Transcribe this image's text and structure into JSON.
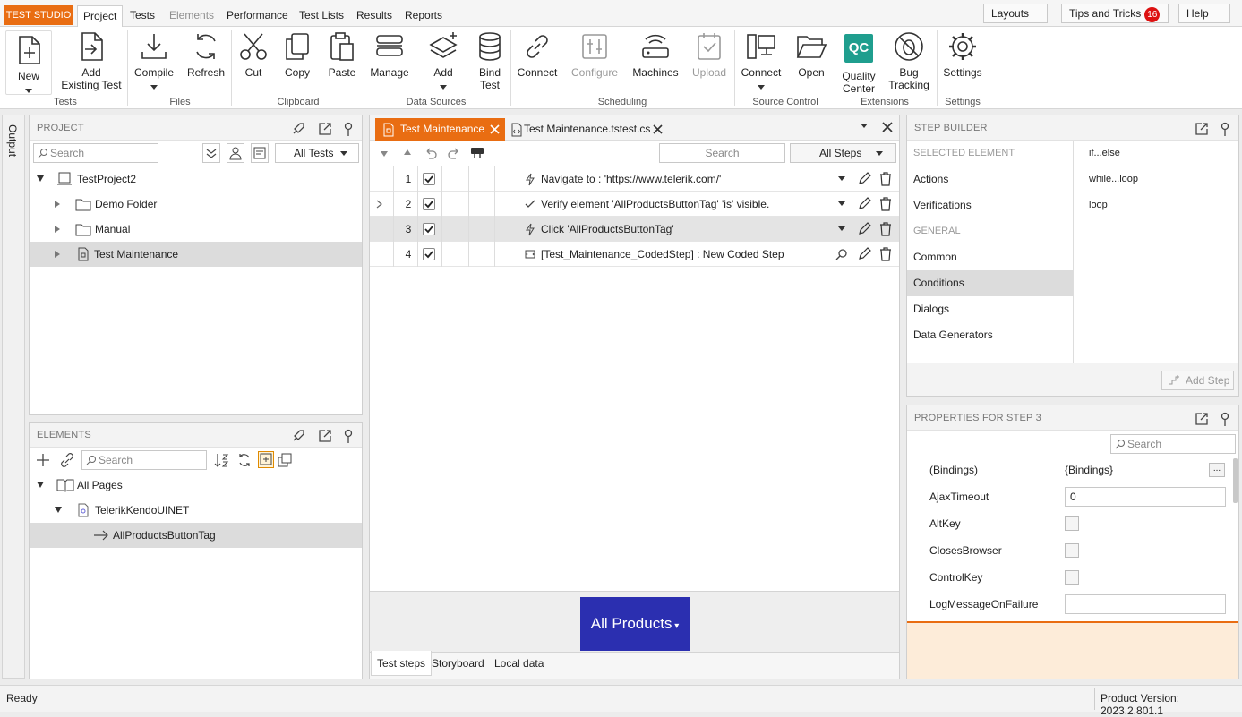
{
  "menubar": {
    "brand": "TEST STUDIO",
    "tabs": [
      "Project",
      "Tests",
      "Elements",
      "Performance",
      "Test Lists",
      "Results",
      "Reports"
    ],
    "layouts": "Layouts",
    "tips": "Tips and Tricks",
    "tips_count": "16",
    "help": "Help"
  },
  "ribbon": {
    "new": "New",
    "add_existing_1": "Add",
    "add_existing_2": "Existing Test",
    "compile": "Compile",
    "refresh": "Refresh",
    "cut": "Cut",
    "copy": "Copy",
    "paste": "Paste",
    "manage": "Manage",
    "add": "Add",
    "bind_1": "Bind",
    "bind_2": "Test",
    "connect": "Connect",
    "configure": "Configure",
    "machines": "Machines",
    "upload": "Upload",
    "sc_connect": "Connect",
    "open": "Open",
    "qc_1": "Quality",
    "qc_2": "Center",
    "qc_badge": "QC",
    "bug_1": "Bug",
    "bug_2": "Tracking",
    "settings": "Settings",
    "groups": {
      "tests": "Tests",
      "files": "Files",
      "clipboard": "Clipboard",
      "data_sources": "Data Sources",
      "scheduling": "Scheduling",
      "source_control": "Source Control",
      "extensions": "Extensions",
      "settings": "Settings"
    }
  },
  "output_tab": "Output",
  "project": {
    "title": "PROJECT",
    "search_placeholder": "Search",
    "filter": "All Tests",
    "tree": [
      {
        "label": "TestProject2"
      },
      {
        "label": "Demo Folder"
      },
      {
        "label": "Manual"
      },
      {
        "label": "Test Maintenance"
      }
    ]
  },
  "elements": {
    "title": "ELEMENTS",
    "search_placeholder": "Search",
    "tree": [
      {
        "label": "All Pages"
      },
      {
        "label": "TelerikKendoUINET"
      },
      {
        "label": "AllProductsButtonTag"
      }
    ]
  },
  "editor": {
    "tabs": [
      {
        "label": "Test Maintenance"
      },
      {
        "label": "Test Maintenance.tstest.cs"
      }
    ],
    "search_placeholder": "Search",
    "filter": "All Steps",
    "steps": [
      {
        "num": "1",
        "text": "Navigate to : 'https://www.telerik.com/'"
      },
      {
        "num": "2",
        "text": "Verify element 'AllProductsButtonTag' 'is' visible."
      },
      {
        "num": "3",
        "text": "Click 'AllProductsButtonTag'"
      },
      {
        "num": "4",
        "text": "[Test_Maintenance_CodedStep] : New Coded Step"
      }
    ],
    "preview_label": "All Products",
    "bottom_tabs": [
      "Test steps",
      "Storyboard",
      "Local data"
    ]
  },
  "step_builder": {
    "title": "STEP BUILDER",
    "selected_element": "SELECTED ELEMENT",
    "actions": "Actions",
    "verifications": "Verifications",
    "general": "GENERAL",
    "common": "Common",
    "conditions": "Conditions",
    "dialogs": "Dialogs",
    "data_generators": "Data Generators",
    "options": [
      "if...else",
      "while...loop",
      "loop"
    ],
    "add_step": "Add Step"
  },
  "properties": {
    "title": "PROPERTIES FOR STEP 3",
    "search_placeholder": "Search",
    "rows": [
      {
        "name": "(Bindings)",
        "value": "{Bindings}"
      },
      {
        "name": "AjaxTimeout",
        "value": "0"
      },
      {
        "name": "AltKey"
      },
      {
        "name": "ClosesBrowser"
      },
      {
        "name": "ControlKey"
      },
      {
        "name": "LogMessageOnFailure",
        "value": ""
      }
    ],
    "more": "..."
  },
  "status": {
    "left": "Ready",
    "version": "Product Version: 2023.2.801.1"
  },
  "colors": {
    "accent": "#e96d12",
    "qc": "#1f9e8e",
    "preview": "#2b2fb0"
  }
}
